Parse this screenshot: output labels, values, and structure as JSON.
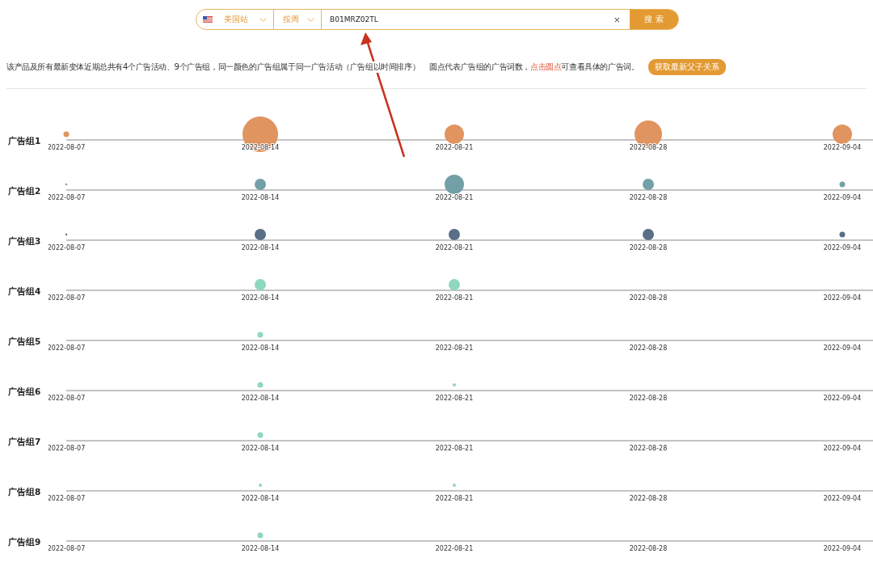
{
  "search": {
    "site": "美国站",
    "period": "按周",
    "value": "B01MRZ02TL",
    "clear": "×",
    "button": "搜 索"
  },
  "info": {
    "text": "该产品及所有最新变体近期总共有4个广告活动、9个广告组，同一颜色的广告组属于同一广告活动（广告组以时间排序）",
    "legend_before": "圆点代表广告组的广告词数，",
    "legend_link": "点击圆点",
    "legend_after": "可查看具体的广告词。",
    "button": "获取最新父子关系"
  },
  "groups": [
    {
      "label": "广告组1",
      "color": "#e0945f",
      "weeks": [
        {
          "date": "2022-08-07",
          "kind": "small"
        },
        {
          "date": "2022-08-14",
          "kind": "huge"
        },
        {
          "date": "2022-08-21",
          "kind": "large"
        },
        {
          "date": "2022-08-28",
          "kind": "big"
        },
        {
          "date": "2022-09-04",
          "kind": "large"
        }
      ]
    },
    {
      "label": "广告组2",
      "color": "#72a0a6",
      "weeks": [
        {
          "date": "2022-08-07",
          "kind": "dot"
        },
        {
          "date": "2022-08-14",
          "kind": "medium"
        },
        {
          "date": "2022-08-21",
          "kind": "large"
        },
        {
          "date": "2022-08-28",
          "kind": "medium"
        },
        {
          "date": "2022-09-04",
          "kind": "small"
        }
      ]
    },
    {
      "label": "广告组3",
      "color": "#5a6e86",
      "weeks": [
        {
          "date": "2022-08-07",
          "kind": "dot"
        },
        {
          "date": "2022-08-14",
          "kind": "medium"
        },
        {
          "date": "2022-08-21",
          "kind": "medium"
        },
        {
          "date": "2022-08-28",
          "kind": "medium"
        },
        {
          "date": "2022-09-04",
          "kind": "small"
        }
      ]
    },
    {
      "label": "广告组4",
      "color": "#8ed8bd",
      "weeks": [
        {
          "date": "2022-08-07",
          "kind": "none"
        },
        {
          "date": "2022-08-14",
          "kind": "medium"
        },
        {
          "date": "2022-08-21",
          "kind": "medium"
        },
        {
          "date": "2022-08-28",
          "kind": "none"
        },
        {
          "date": "2022-09-04",
          "kind": "none"
        }
      ]
    },
    {
      "label": "广告组5",
      "color": "#8ed8bd",
      "weeks": [
        {
          "date": "2022-08-07",
          "kind": "none"
        },
        {
          "date": "2022-08-14",
          "kind": "small"
        },
        {
          "date": "2022-08-21",
          "kind": "none"
        },
        {
          "date": "2022-08-28",
          "kind": "none"
        },
        {
          "date": "2022-09-04",
          "kind": "none"
        }
      ]
    },
    {
      "label": "广告组6",
      "color": "#8ed8bd",
      "weeks": [
        {
          "date": "2022-08-07",
          "kind": "none"
        },
        {
          "date": "2022-08-14",
          "kind": "small"
        },
        {
          "date": "2022-08-21",
          "kind": "tiny"
        },
        {
          "date": "2022-08-28",
          "kind": "none"
        },
        {
          "date": "2022-09-04",
          "kind": "none"
        }
      ]
    },
    {
      "label": "广告组7",
      "color": "#8ed8bd",
      "weeks": [
        {
          "date": "2022-08-07",
          "kind": "none"
        },
        {
          "date": "2022-08-14",
          "kind": "small"
        },
        {
          "date": "2022-08-21",
          "kind": "none"
        },
        {
          "date": "2022-08-28",
          "kind": "none"
        },
        {
          "date": "2022-09-04",
          "kind": "none"
        }
      ]
    },
    {
      "label": "广告组8",
      "color": "#8ed8bd",
      "weeks": [
        {
          "date": "2022-08-07",
          "kind": "none"
        },
        {
          "date": "2022-08-14",
          "kind": "tiny"
        },
        {
          "date": "2022-08-21",
          "kind": "tiny"
        },
        {
          "date": "2022-08-28",
          "kind": "none"
        },
        {
          "date": "2022-09-04",
          "kind": "none"
        }
      ]
    },
    {
      "label": "广告组9",
      "color": "#8ed8bd",
      "weeks": [
        {
          "date": "2022-08-07",
          "kind": "none"
        },
        {
          "date": "2022-08-14",
          "kind": "small"
        },
        {
          "date": "2022-08-21",
          "kind": "none"
        },
        {
          "date": "2022-08-28",
          "kind": "none"
        },
        {
          "date": "2022-09-04",
          "kind": "none"
        }
      ]
    }
  ]
}
